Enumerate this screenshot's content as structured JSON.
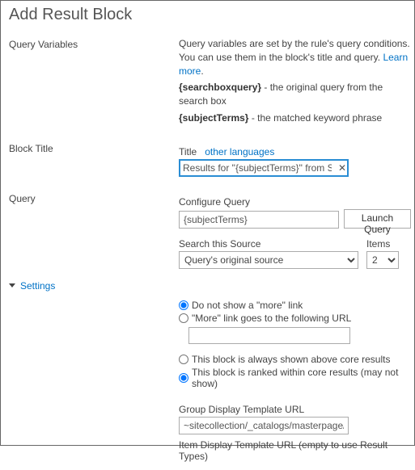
{
  "title": "Add Result Block",
  "sections": {
    "query_vars": {
      "label": "Query Variables",
      "desc_pre": "Query variables are set by the rule's query conditions. You can use them in the block's title and query. ",
      "learn_more": "Learn more",
      "desc_post": ".",
      "line1_key": "{searchboxquery}",
      "line1_val": " - the original query from the search box",
      "line2_key": "{subjectTerms}",
      "line2_val": " - the matched keyword phrase"
    },
    "block_title": {
      "label": "Block Title",
      "title_label": "Title",
      "other_langs": "other languages",
      "title_value": "Results for \"{subjectTerms}\" from ShareP"
    },
    "query": {
      "label": "Query",
      "configure_label": "Configure Query",
      "configure_value": "{subjectTerms}",
      "launch_btn": "Launch Query",
      "source_label": "Search this Source",
      "source_value": "Query's original source",
      "items_label": "Items",
      "items_value": "2"
    }
  },
  "settings": {
    "toggle": "Settings",
    "more_none": "Do not show a \"more\" link",
    "more_url": "\"More\" link goes to the following URL",
    "more_url_value": "",
    "placement_above": "This block is always shown above core results",
    "placement_ranked": "This block is ranked within core results (may not show)",
    "group_tpl_label": "Group Display Template URL",
    "group_tpl_value": "~sitecollection/_catalogs/masterpage/Displ",
    "item_tpl_label": "Item Display Template URL (empty to use Result Types)"
  }
}
